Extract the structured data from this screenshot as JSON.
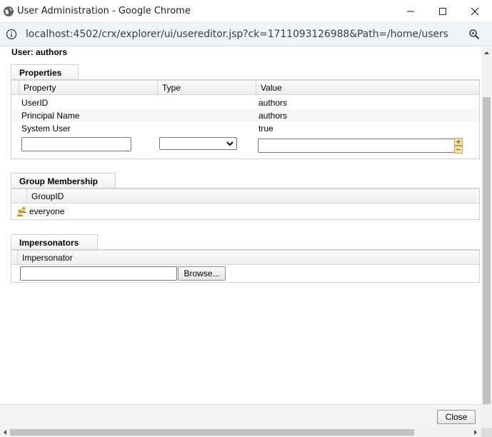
{
  "window": {
    "title": "User Administration - Google Chrome",
    "url": "localhost:4502/crx/explorer/ui/usereditor.jsp?ck=1711093126988&Path=/home/users"
  },
  "user": {
    "header": "User: authors"
  },
  "properties": {
    "tab_label": "Properties",
    "columns": [
      "Property",
      "Type",
      "Value"
    ],
    "rows": [
      {
        "property": "UserID",
        "type": "",
        "value": "authors"
      },
      {
        "property": "Principal Name",
        "type": "",
        "value": "authors"
      },
      {
        "property": "System User",
        "type": "",
        "value": "true"
      }
    ],
    "new_property_value": "",
    "new_type_value": "",
    "new_value_value": ""
  },
  "groups": {
    "tab_label": "Group Membership",
    "columns": [
      "GroupID"
    ],
    "rows": [
      {
        "group": "everyone",
        "icon": "group-icon"
      }
    ]
  },
  "impersonators": {
    "tab_label": "Impersonators",
    "columns": [
      "Impersonator"
    ],
    "input_value": "",
    "browse_label": "Browse..."
  },
  "footer": {
    "close_label": "Close"
  },
  "colors": {
    "accent": "#d0d0d0",
    "titlebar_bg": "#ffffff",
    "addressbar_bg": "#f1f3f4"
  },
  "icons": {
    "app": "globe-icon",
    "minimize": "minimize-icon",
    "maximize": "maximize-icon",
    "close": "close-icon",
    "info": "info-icon",
    "zoom": "zoom-icon",
    "add": "plus-icon",
    "remove": "minus-icon"
  }
}
